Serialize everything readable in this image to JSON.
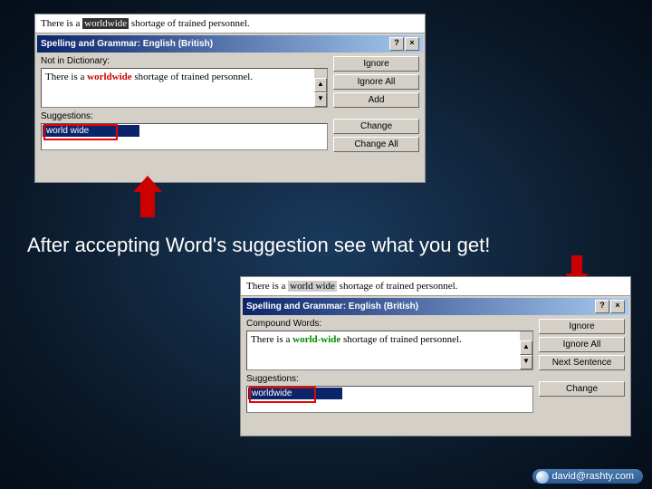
{
  "caption": "After accepting Word's suggestion see what you get!",
  "shot1": {
    "doc_prefix": "There is a ",
    "doc_highlight": "worldwide",
    "doc_suffix": " shortage of trained personnel.",
    "dialog_title": "Spelling and Grammar: English (British)",
    "section_label": "Not in Dictionary:",
    "sentence_prefix": "There is a ",
    "sentence_error": "worldwide",
    "sentence_suffix": " shortage of trained personnel.",
    "suggestions_label": "Suggestions:",
    "suggestion": "world wide",
    "buttons": {
      "ignore": "Ignore",
      "ignore_all": "Ignore All",
      "add": "Add",
      "change": "Change",
      "change_all": "Change All"
    }
  },
  "shot2": {
    "doc_prefix": "There is a ",
    "doc_highlight": "world wide",
    "doc_suffix": " shortage of trained personnel.",
    "dialog_title": "Spelling and Grammar: English (British)",
    "section_label": "Compound Words:",
    "sentence_prefix": "There is a ",
    "sentence_error": "world-wide",
    "sentence_suffix": " shortage of trained personnel.",
    "suggestions_label": "Suggestions:",
    "suggestion": "worldwide",
    "buttons": {
      "ignore": "Ignore",
      "ignore_all": "Ignore All",
      "next": "Next Sentence",
      "change": "Change"
    }
  },
  "footer": "david@rashty.com"
}
